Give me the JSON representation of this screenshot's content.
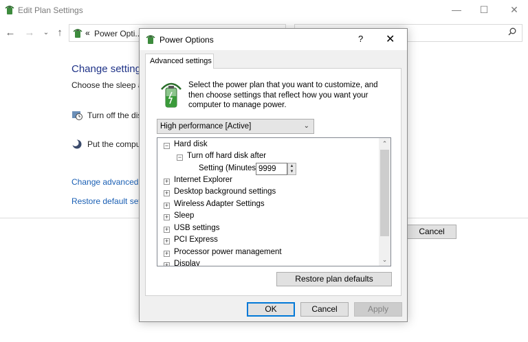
{
  "background_window": {
    "title": "Edit Plan Settings",
    "address": {
      "separator": "«",
      "breadcrumb": "Power Opti..."
    },
    "heading": "Change setting",
    "subtitle": "Choose the sleep an",
    "rows": [
      {
        "label": "Turn off the dis"
      },
      {
        "label": "Put the compu"
      }
    ],
    "links": [
      {
        "label": "Change advanced p"
      },
      {
        "label": "Restore default sett"
      }
    ],
    "cancel_label": "Cancel"
  },
  "dialog": {
    "title": "Power Options",
    "help_label": "?",
    "close_label": "✕",
    "tab_label": "Advanced settings",
    "description": "Select the power plan that you want to customize, and then choose settings that reflect how you want your computer to manage power.",
    "plan_selected": "High performance [Active]",
    "tree": {
      "items": [
        {
          "label": "Hard disk",
          "expander": "−",
          "level": 0
        },
        {
          "label": "Turn off hard disk after",
          "expander": "−",
          "level": 1
        },
        {
          "label": "Setting (Minutes):",
          "value": "9999",
          "level": 2
        },
        {
          "label": "Internet Explorer",
          "expander": "+",
          "level": 0
        },
        {
          "label": "Desktop background settings",
          "expander": "+",
          "level": 0
        },
        {
          "label": "Wireless Adapter Settings",
          "expander": "+",
          "level": 0
        },
        {
          "label": "Sleep",
          "expander": "+",
          "level": 0
        },
        {
          "label": "USB settings",
          "expander": "+",
          "level": 0
        },
        {
          "label": "PCI Express",
          "expander": "+",
          "level": 0
        },
        {
          "label": "Processor power management",
          "expander": "+",
          "level": 0
        },
        {
          "label": "Display",
          "expander": "+",
          "level": 0
        }
      ]
    },
    "restore_label": "Restore plan defaults",
    "ok_label": "OK",
    "cancel_label": "Cancel",
    "apply_label": "Apply"
  },
  "colors": {
    "link": "#1a5fb4",
    "heading": "#1e3287",
    "accent": "#0078d7"
  }
}
